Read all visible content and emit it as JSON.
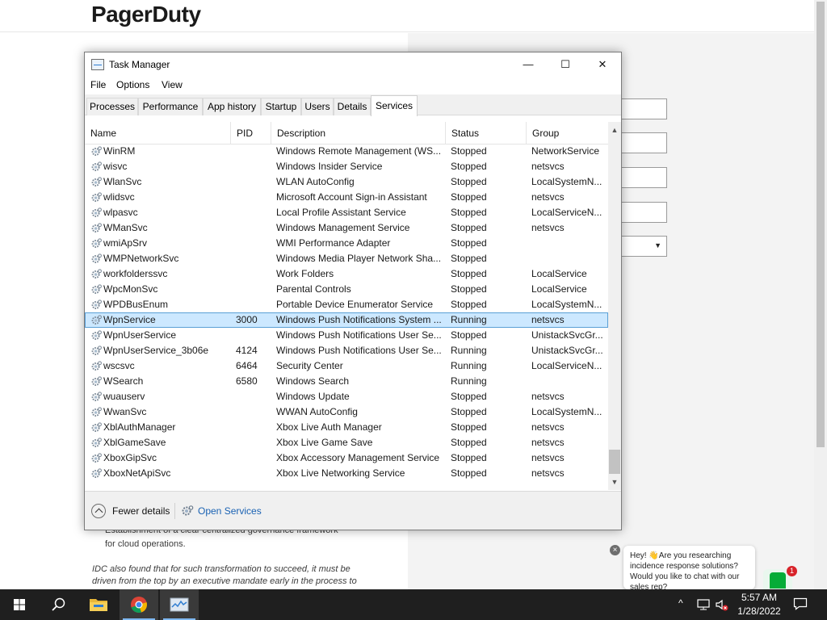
{
  "background_page": {
    "logo": "PagerDuty",
    "bullet_text": "Establishment of a clear centralized governance framework",
    "bullet_text_2": "for cloud operations.",
    "para_line1": "IDC also found that for such transformation to succeed, it must be",
    "para_line2": "driven from the top by an executive mandate early in the process to",
    "chat_text": "Hey! 👋Are you researching incidence response solutions? Would you like to chat with our sales rep?",
    "chat_badge": "1"
  },
  "window": {
    "title": "Task Manager",
    "controls": {
      "minimize": "—",
      "maximize": "☐",
      "close": "✕"
    }
  },
  "menu": [
    "File",
    "Options",
    "View"
  ],
  "tabs": [
    {
      "label": "Processes",
      "active": false
    },
    {
      "label": "Performance",
      "active": false
    },
    {
      "label": "App history",
      "active": false
    },
    {
      "label": "Startup",
      "active": false
    },
    {
      "label": "Users",
      "active": false
    },
    {
      "label": "Details",
      "active": false
    },
    {
      "label": "Services",
      "active": true
    }
  ],
  "table": {
    "columns": [
      "Name",
      "PID",
      "Description",
      "Status",
      "Group"
    ],
    "sort_indicator": "^",
    "rows": [
      {
        "name": "WinRM",
        "pid": "",
        "description": "Windows Remote Management (WS...",
        "status": "Stopped",
        "group": "NetworkService"
      },
      {
        "name": "wisvc",
        "pid": "",
        "description": "Windows Insider Service",
        "status": "Stopped",
        "group": "netsvcs"
      },
      {
        "name": "WlanSvc",
        "pid": "",
        "description": "WLAN AutoConfig",
        "status": "Stopped",
        "group": "LocalSystemN..."
      },
      {
        "name": "wlidsvc",
        "pid": "",
        "description": "Microsoft Account Sign-in Assistant",
        "status": "Stopped",
        "group": "netsvcs"
      },
      {
        "name": "wlpasvc",
        "pid": "",
        "description": "Local Profile Assistant Service",
        "status": "Stopped",
        "group": "LocalServiceN..."
      },
      {
        "name": "WManSvc",
        "pid": "",
        "description": "Windows Management Service",
        "status": "Stopped",
        "group": "netsvcs"
      },
      {
        "name": "wmiApSrv",
        "pid": "",
        "description": "WMI Performance Adapter",
        "status": "Stopped",
        "group": ""
      },
      {
        "name": "WMPNetworkSvc",
        "pid": "",
        "description": "Windows Media Player Network Sha...",
        "status": "Stopped",
        "group": ""
      },
      {
        "name": "workfolderssvc",
        "pid": "",
        "description": "Work Folders",
        "status": "Stopped",
        "group": "LocalService"
      },
      {
        "name": "WpcMonSvc",
        "pid": "",
        "description": "Parental Controls",
        "status": "Stopped",
        "group": "LocalService"
      },
      {
        "name": "WPDBusEnum",
        "pid": "",
        "description": "Portable Device Enumerator Service",
        "status": "Stopped",
        "group": "LocalSystemN..."
      },
      {
        "name": "WpnService",
        "pid": "3000",
        "description": "Windows Push Notifications System ...",
        "status": "Running",
        "group": "netsvcs",
        "selected": true
      },
      {
        "name": "WpnUserService",
        "pid": "",
        "description": "Windows Push Notifications User Se...",
        "status": "Stopped",
        "group": "UnistackSvcGr..."
      },
      {
        "name": "WpnUserService_3b06e",
        "pid": "4124",
        "description": "Windows Push Notifications User Se...",
        "status": "Running",
        "group": "UnistackSvcGr..."
      },
      {
        "name": "wscsvc",
        "pid": "6464",
        "description": "Security Center",
        "status": "Running",
        "group": "LocalServiceN..."
      },
      {
        "name": "WSearch",
        "pid": "6580",
        "description": "Windows Search",
        "status": "Running",
        "group": ""
      },
      {
        "name": "wuauserv",
        "pid": "",
        "description": "Windows Update",
        "status": "Stopped",
        "group": "netsvcs"
      },
      {
        "name": "WwanSvc",
        "pid": "",
        "description": "WWAN AutoConfig",
        "status": "Stopped",
        "group": "LocalSystemN..."
      },
      {
        "name": "XblAuthManager",
        "pid": "",
        "description": "Xbox Live Auth Manager",
        "status": "Stopped",
        "group": "netsvcs"
      },
      {
        "name": "XblGameSave",
        "pid": "",
        "description": "Xbox Live Game Save",
        "status": "Stopped",
        "group": "netsvcs"
      },
      {
        "name": "XboxGipSvc",
        "pid": "",
        "description": "Xbox Accessory Management Service",
        "status": "Stopped",
        "group": "netsvcs"
      },
      {
        "name": "XboxNetApiSvc",
        "pid": "",
        "description": "Xbox Live Networking Service",
        "status": "Stopped",
        "group": "netsvcs"
      }
    ]
  },
  "footer": {
    "fewer_details": "Fewer details",
    "open_services": "Open Services"
  },
  "taskbar": {
    "time": "5:57 AM",
    "date": "1/28/2022",
    "tray_chevron": "^"
  },
  "colors": {
    "selected_row": "#cce8ff",
    "link": "#1a62b3",
    "taskbar": "#1f1f1f",
    "pagerduty_green": "#06ac38"
  }
}
